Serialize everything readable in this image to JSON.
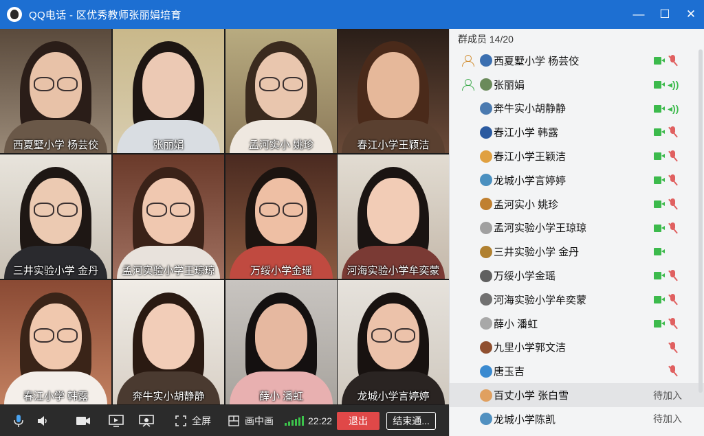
{
  "window": {
    "app": "QQ电话",
    "separator": " - ",
    "title": "区优秀教师张丽娟培育",
    "minimize": "—",
    "maximize": "☐",
    "close": "✕"
  },
  "videos": [
    {
      "name": "西夏墅小学 杨芸佼"
    },
    {
      "name": "张丽娟"
    },
    {
      "name": "孟河实小 姚珍"
    },
    {
      "name": "春江小学王颖洁"
    },
    {
      "name": "三井实验小学 金丹"
    },
    {
      "name": "孟河实验小学王琼琼"
    },
    {
      "name": "万绥小学金瑶"
    },
    {
      "name": "河海实验小学牟奕蒙"
    },
    {
      "name": "春江小学 韩露"
    },
    {
      "name": "奔牛实小胡静静"
    },
    {
      "name": "薛小 潘虹"
    },
    {
      "name": "龙城小学言婷婷"
    }
  ],
  "toolbar": {
    "fullscreen": "全屏",
    "pip": "画中画",
    "timer": "22:22",
    "exit": "退出",
    "end": "结束通..."
  },
  "panel": {
    "header": "群成员 14/20",
    "members": [
      {
        "name": "西夏墅小学 杨芸佼",
        "host": "orange",
        "status": "cam-muted"
      },
      {
        "name": "张丽娟",
        "host": "green",
        "status": "cam-speaking"
      },
      {
        "name": "奔牛实小胡静静",
        "host": "",
        "status": "cam-speaking"
      },
      {
        "name": "春江小学 韩露",
        "host": "",
        "status": "cam-muted"
      },
      {
        "name": "春江小学王颖洁",
        "host": "",
        "status": "cam-muted"
      },
      {
        "name": "龙城小学言婷婷",
        "host": "",
        "status": "cam-muted"
      },
      {
        "name": "孟河实小 姚珍",
        "host": "",
        "status": "cam-muted"
      },
      {
        "name": "孟河实验小学王琼琼",
        "host": "",
        "status": "cam-muted"
      },
      {
        "name": "三井实验小学 金丹",
        "host": "",
        "status": "cam"
      },
      {
        "name": "万绥小学金瑶",
        "host": "",
        "status": "cam-muted"
      },
      {
        "name": "河海实验小学牟奕蒙",
        "host": "",
        "status": "cam-muted"
      },
      {
        "name": "薛小 潘虹",
        "host": "",
        "status": "cam-muted"
      },
      {
        "name": "九里小学郭文洁",
        "host": "",
        "status": "muted"
      },
      {
        "name": "唐玉吉",
        "host": "",
        "status": "muted"
      },
      {
        "name": "百丈小学 张白雪",
        "host": "",
        "status": "waiting",
        "waiting_text": "待加入"
      },
      {
        "name": "龙城小学陈凯",
        "host": "",
        "status": "waiting",
        "waiting_text": "待加入"
      }
    ]
  },
  "colors": {
    "titlebar": "#1d6fd2",
    "exit": "#e04848",
    "online_green": "#3cba4c",
    "muted_red": "#e06060"
  }
}
